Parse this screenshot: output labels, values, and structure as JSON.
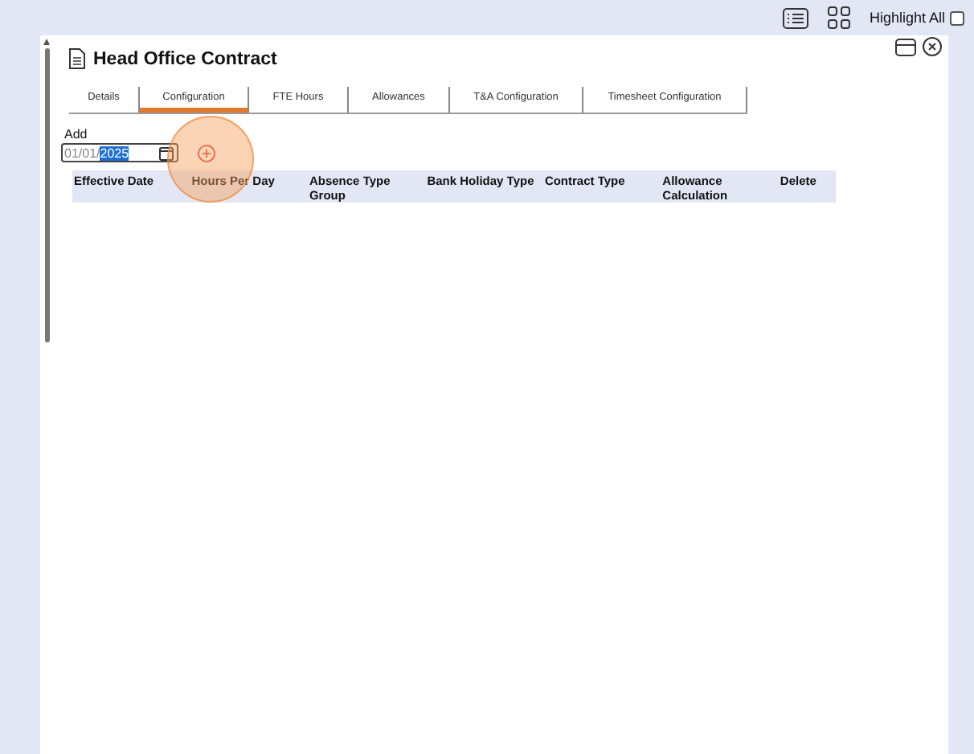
{
  "toolbar": {
    "highlight_all": {
      "label": "Highlight All",
      "checked": false
    }
  },
  "window": {
    "title": "Head Office Contract"
  },
  "tabs": [
    {
      "label": "Details",
      "selected": false
    },
    {
      "label": "Configuration",
      "selected": true
    },
    {
      "label": "FTE Hours",
      "selected": false
    },
    {
      "label": "Allowances",
      "selected": false
    },
    {
      "label": "T&A Configuration",
      "selected": false
    },
    {
      "label": "Timesheet Configuration",
      "selected": false
    }
  ],
  "add": {
    "label": "Add",
    "date_value": "01/01/",
    "date_selected": "2025"
  },
  "table": {
    "columns": [
      "Effective Date",
      "Hours Per Day",
      "Absence Type Group",
      "Bank Holiday Type",
      "Contract Type",
      "Allowance Calculation",
      "Delete"
    ]
  }
}
